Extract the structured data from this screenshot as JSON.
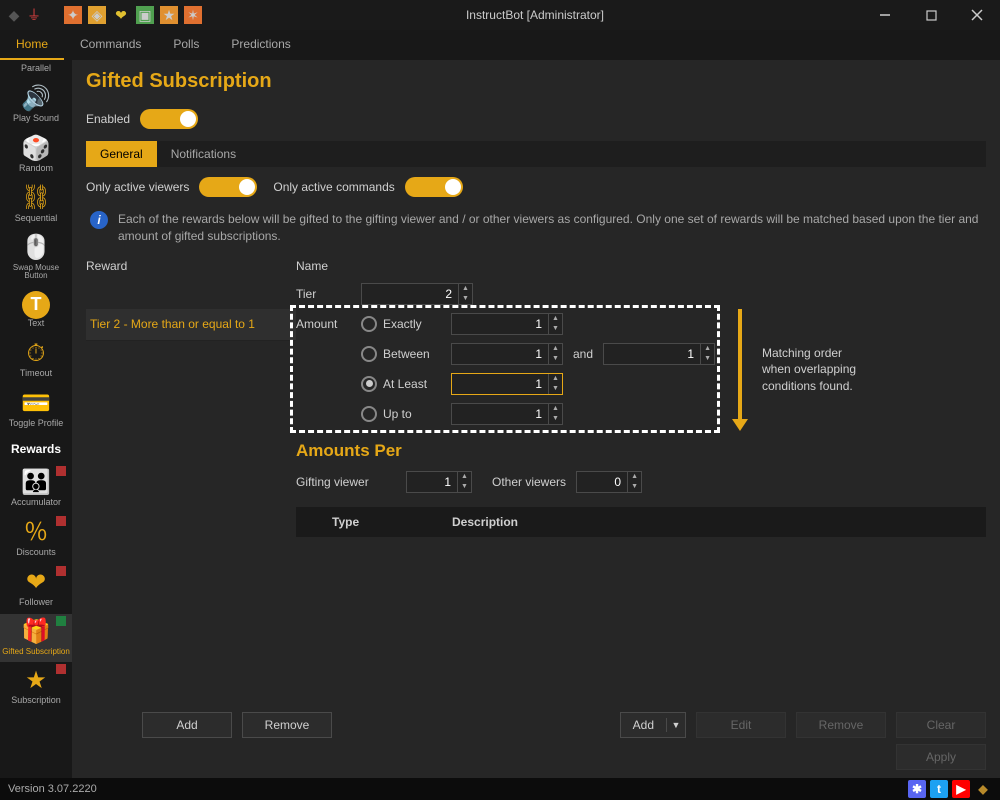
{
  "title": "InstructBot [Administrator]",
  "maintabs": [
    "Home",
    "Commands",
    "Polls",
    "Predictions"
  ],
  "maintab_active": 0,
  "sidebar": [
    {
      "label": "Parallel",
      "kind": "item"
    },
    {
      "label": "Play Sound",
      "kind": "item"
    },
    {
      "label": "Random",
      "kind": "item"
    },
    {
      "label": "Sequential",
      "kind": "item"
    },
    {
      "label": "Swap Mouse Button",
      "kind": "item"
    },
    {
      "label": "Text",
      "kind": "item"
    },
    {
      "label": "Timeout",
      "kind": "item"
    },
    {
      "label": "Toggle Profile",
      "kind": "item"
    },
    {
      "label": "Rewards",
      "kind": "category"
    },
    {
      "label": "Accumulator",
      "kind": "item",
      "badge": "red"
    },
    {
      "label": "Discounts",
      "kind": "item",
      "badge": "red"
    },
    {
      "label": "Follower",
      "kind": "item",
      "badge": "red"
    },
    {
      "label": "Gifted Subscription",
      "kind": "item",
      "badge": "green",
      "active": true
    },
    {
      "label": "Subscription",
      "kind": "item",
      "badge": "red"
    }
  ],
  "page": {
    "title": "Gifted Subscription",
    "enabled_label": "Enabled",
    "subtabs": [
      "General",
      "Notifications"
    ],
    "subtab_active": 0,
    "only_active_viewers": "Only active viewers",
    "only_active_commands": "Only active commands",
    "info_text": "Each of the rewards below will be gifted to the gifting viewer and / or other viewers as configured. Only one set of rewards will be matched based upon the tier and amount of gifted subscriptions.",
    "col_reward": "Reward",
    "col_name": "Name",
    "reward_item": "Tier 2 - More than or equal to 1",
    "tier_label": "Tier",
    "tier_value": "2",
    "amount_label": "Amount",
    "amount_options": {
      "exactly": "Exactly",
      "between": "Between",
      "atleast": "At Least",
      "upto": "Up to"
    },
    "between_and": "and",
    "amount_exactly_value": "1",
    "amount_between_a": "1",
    "amount_between_b": "1",
    "amount_atleast_value": "1",
    "amount_upto_value": "1",
    "match_order_text": "Matching order when overlapping conditions found.",
    "amounts_per_title": "Amounts Per",
    "gifting_viewer_label": "Gifting viewer",
    "gifting_viewer_value": "1",
    "other_viewers_label": "Other viewers",
    "other_viewers_value": "0",
    "type_header": "Type",
    "description_header": "Description"
  },
  "buttons": {
    "add": "Add",
    "remove": "Remove",
    "edit": "Edit",
    "clear": "Clear",
    "apply": "Apply"
  },
  "footer": {
    "version": "Version 3.07.2220"
  }
}
